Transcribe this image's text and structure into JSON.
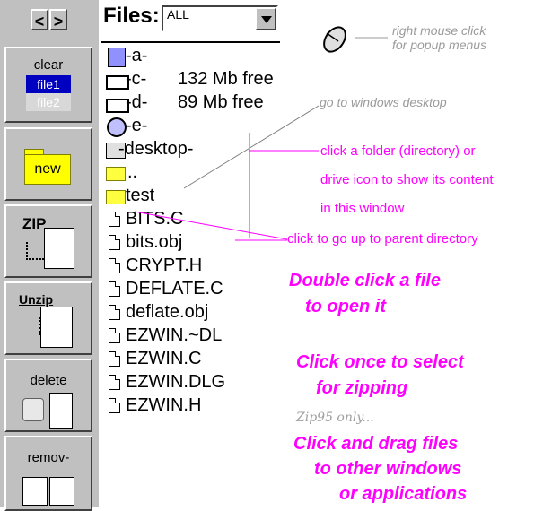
{
  "nav": {
    "prev": "<",
    "next": ">"
  },
  "files_header": {
    "label": "Files:",
    "filter_value": "ALL"
  },
  "toolbar": {
    "clear": {
      "label": "clear",
      "icon_line1": "file1",
      "icon_line2": "file2"
    },
    "new": {
      "label": "new"
    },
    "zip": {
      "label": "ZIP"
    },
    "unzip": {
      "label": "Unzip"
    },
    "delete": {
      "label": "delete"
    },
    "remove": {
      "label": "remov-"
    }
  },
  "rows": [
    {
      "name": "-a-",
      "icon": "floppy-icon",
      "info": ""
    },
    {
      "name": "-c-",
      "icon": "hard-drive-icon",
      "info": "132 Mb free"
    },
    {
      "name": "-d-",
      "icon": "hard-drive-icon",
      "info": "89 Mb free"
    },
    {
      "name": "-e-",
      "icon": "cd-drive-icon",
      "info": ""
    },
    {
      "name": "-desktop-",
      "icon": "desktop-icon",
      "info": ""
    },
    {
      "name": "..",
      "icon": "parent-folder-icon",
      "info": ""
    },
    {
      "name": "test",
      "icon": "folder-icon",
      "info": ""
    },
    {
      "name": "BITS.C",
      "icon": "file-icon",
      "info": ""
    },
    {
      "name": "bits.obj",
      "icon": "file-icon",
      "info": ""
    },
    {
      "name": "CRYPT.H",
      "icon": "file-icon",
      "info": ""
    },
    {
      "name": "DEFLATE.C",
      "icon": "file-icon",
      "info": ""
    },
    {
      "name": "deflate.obj",
      "icon": "file-icon",
      "info": ""
    },
    {
      "name": "EZWIN.~DL",
      "icon": "file-icon",
      "info": ""
    },
    {
      "name": "EZWIN.C",
      "icon": "file-icon",
      "info": ""
    },
    {
      "name": "EZWIN.DLG",
      "icon": "file-icon",
      "info": ""
    },
    {
      "name": "EZWIN.H",
      "icon": "file-icon",
      "info": ""
    }
  ],
  "annotations": {
    "mouse_line1": "right mouse click",
    "mouse_line2": "for popup menus",
    "desktop": "go to windows desktop",
    "folder_line1": "click a folder (directory) or",
    "folder_line2": "drive icon to show its content",
    "folder_line3": "in this window",
    "parent": "click to go up to parent directory",
    "dbl_line1": "Double click a file",
    "dbl_line2": "to open it",
    "once_line1": "Click once to select",
    "once_line2": "for zipping",
    "zip95": "Zip95 only...",
    "drag_line1": "Click and drag files",
    "drag_line2": "to other windows",
    "drag_line3": "or applications"
  },
  "colors": {
    "toolbar_bg": "#c0c0c0",
    "annotation_magenta": "#ff00ff",
    "annotation_gray": "#9a9a9a",
    "folder_yellow": "#ffff00"
  }
}
